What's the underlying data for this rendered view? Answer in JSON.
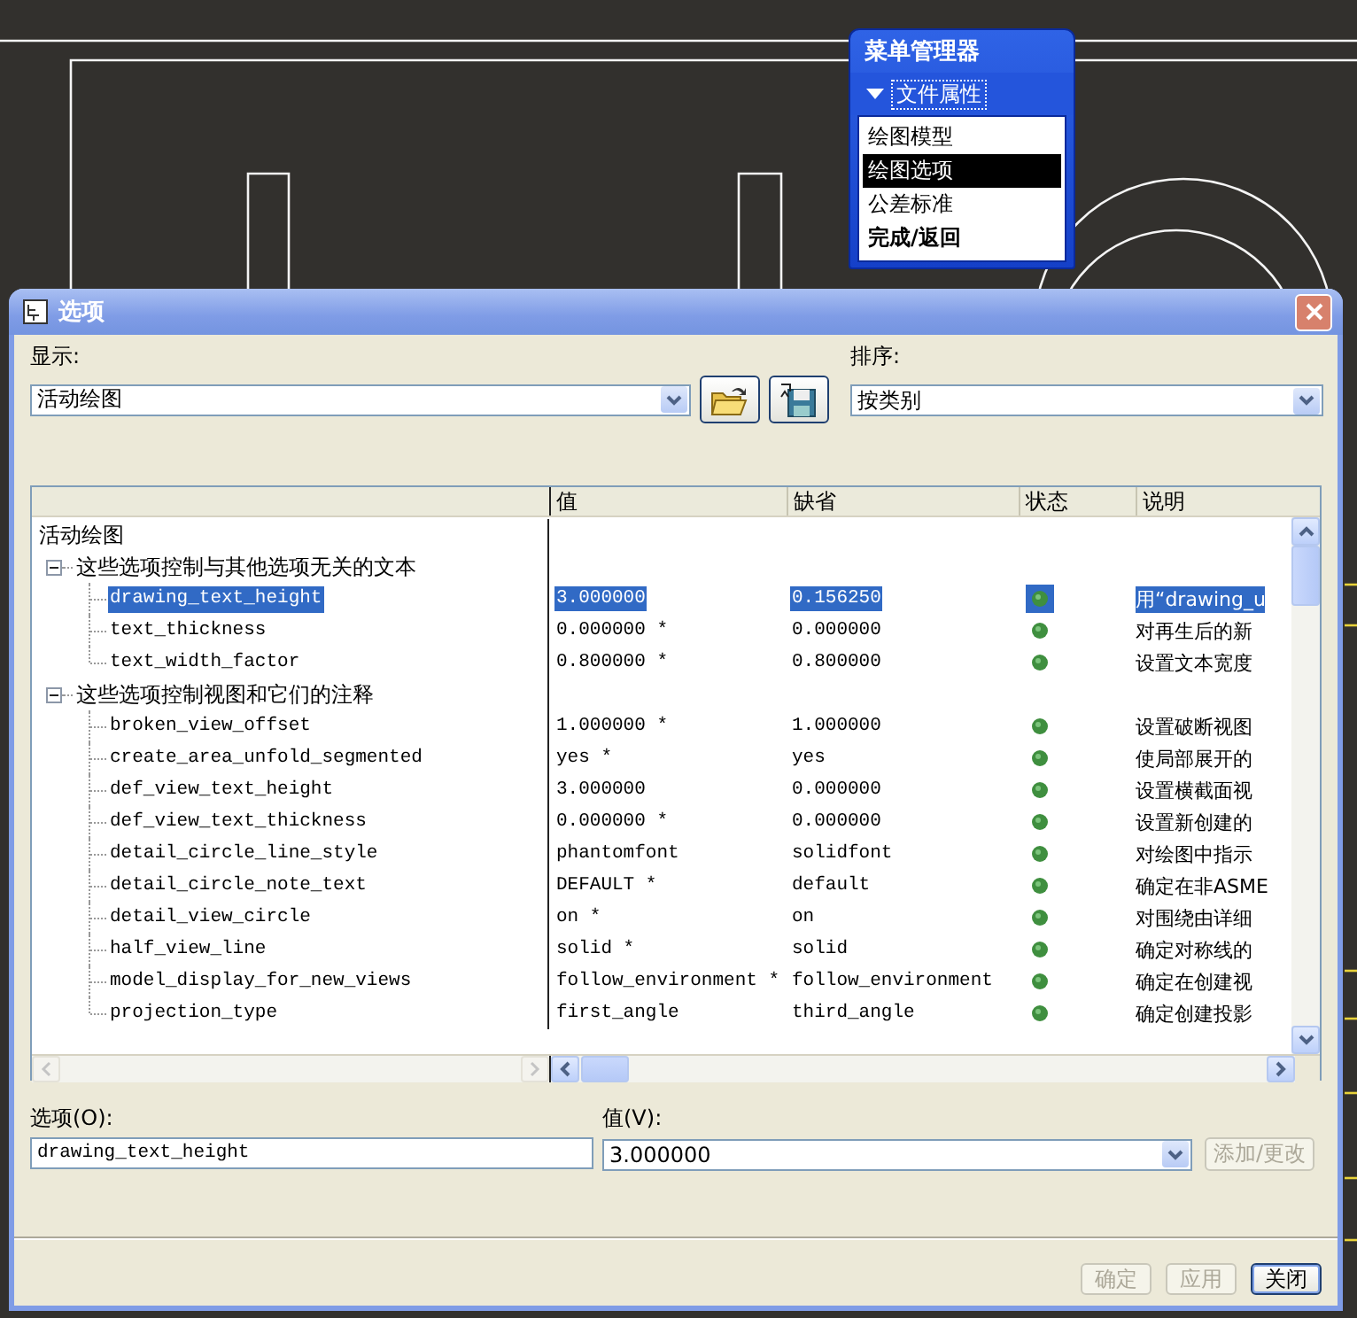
{
  "menu_manager": {
    "title": "菜单管理器",
    "section": {
      "label": "文件属性",
      "expanded": true
    },
    "items": [
      {
        "label": "绘图模型",
        "selected": false,
        "bold": false
      },
      {
        "label": "绘图选项",
        "selected": true,
        "bold": false
      },
      {
        "label": "公差标准",
        "selected": false,
        "bold": false
      },
      {
        "label": "完成/返回",
        "selected": false,
        "bold": true
      }
    ]
  },
  "dialog": {
    "title": "选项",
    "display": {
      "label": "显示:",
      "value": "活动绘图"
    },
    "sort": {
      "label": "排序:",
      "value": "按类别"
    },
    "columns": [
      "值",
      "缺省",
      "状态",
      "说明"
    ],
    "tree": {
      "label": "活动绘图",
      "children": [
        {
          "label": "这些选项控制与其他选项无关的文本",
          "expanded": true,
          "children": [
            {
              "name": "drawing_text_height",
              "value": "3.000000",
              "default": "0.156250",
              "description": "用“drawing_u",
              "selected": true
            },
            {
              "name": "text_thickness",
              "value": "0.000000 *",
              "default": "0.000000",
              "description": "对再生后的新",
              "selected": false
            },
            {
              "name": "text_width_factor",
              "value": "0.800000 *",
              "default": "0.800000",
              "description": "设置文本宽度",
              "selected": false
            }
          ]
        },
        {
          "label": "这些选项控制视图和它们的注释",
          "expanded": true,
          "children": [
            {
              "name": "broken_view_offset",
              "value": "1.000000 *",
              "default": "1.000000",
              "description": "设置破断视图",
              "selected": false
            },
            {
              "name": "create_area_unfold_segmented",
              "value": "yes *",
              "default": "yes",
              "description": "使局部展开的",
              "selected": false
            },
            {
              "name": "def_view_text_height",
              "value": "3.000000",
              "default": "0.000000",
              "description": "设置横截面视",
              "selected": false
            },
            {
              "name": "def_view_text_thickness",
              "value": "0.000000 *",
              "default": "0.000000",
              "description": "设置新创建的",
              "selected": false
            },
            {
              "name": "detail_circle_line_style",
              "value": "phantomfont",
              "default": "solidfont",
              "description": "对绘图中指示",
              "selected": false
            },
            {
              "name": "detail_circle_note_text",
              "value": "DEFAULT *",
              "default": "default",
              "description": "确定在非ASME",
              "selected": false
            },
            {
              "name": "detail_view_circle",
              "value": "on *",
              "default": "on",
              "description": "对围绕由详细",
              "selected": false
            },
            {
              "name": "half_view_line",
              "value": "solid *",
              "default": "solid",
              "description": "确定对称线的",
              "selected": false
            },
            {
              "name": "model_display_for_new_views",
              "value": "follow_environment *",
              "default": "follow_environment",
              "description": "确定在创建视",
              "selected": false
            },
            {
              "name": "projection_type",
              "value": "first_angle",
              "default": "third_angle",
              "description": "确定创建投影",
              "selected": false
            }
          ]
        }
      ]
    },
    "option_field": {
      "label": "选项(O):",
      "value": "drawing_text_height"
    },
    "value_field": {
      "label": "值(V):",
      "value": "3.000000"
    },
    "add_button": {
      "label": "添加/更改",
      "disabled": true
    },
    "buttons": [
      {
        "label": "确定",
        "disabled": true
      },
      {
        "label": "应用",
        "disabled": true
      },
      {
        "label": "关闭",
        "disabled": false
      }
    ]
  }
}
